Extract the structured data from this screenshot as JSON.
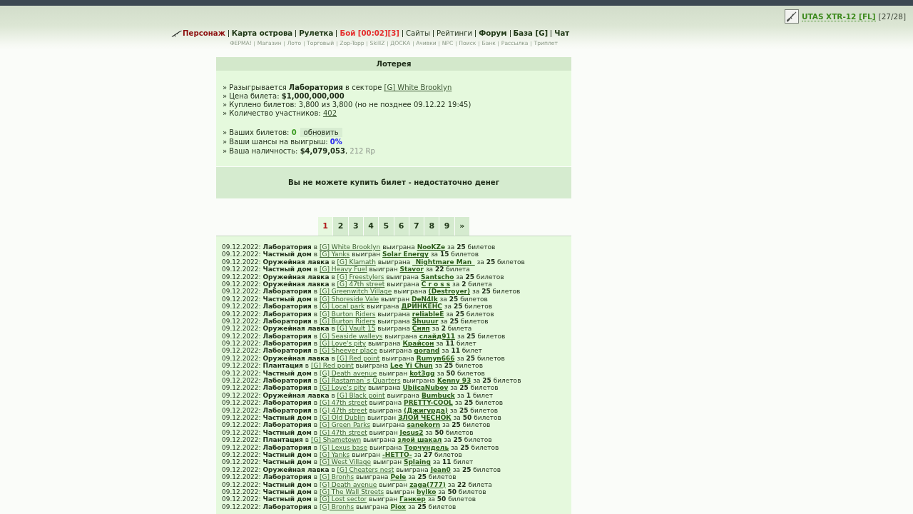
{
  "top_bar": {
    "weapon": {
      "name": "UTAS XTR-12 [FL]",
      "ammo": "[27/28]"
    }
  },
  "nav": {
    "main": [
      {
        "label": "Персонаж",
        "kind": "accent"
      },
      {
        "label": "Карта острова",
        "kind": "bold"
      },
      {
        "label": "Рулетка",
        "kind": "bold"
      },
      {
        "label": "Бой [00:02][3]",
        "kind": "alert"
      },
      {
        "label": "Сайты",
        "kind": "regular"
      },
      {
        "label": "Рейтинги",
        "kind": "regular"
      },
      {
        "label": "Форум",
        "kind": "bold"
      },
      {
        "label": "База [G]",
        "kind": "bold"
      },
      {
        "label": "Чат",
        "kind": "bold"
      }
    ],
    "sub": [
      "ФЕРМА!",
      "Магазин",
      "Лото",
      "Торговый",
      "Zop-Topp",
      "SkillZ",
      "ДОСКА",
      "Ачивки",
      "NPC",
      "Поиск",
      "Банк",
      "Рассылка",
      "Триплет"
    ]
  },
  "lottery": {
    "title": "Лотерея",
    "info_groups": [
      [
        {
          "kind": "link",
          "text": "» Разыгрывается **Лаборатория** в секторе",
          "link": "[G] White Brooklyn"
        },
        {
          "kind": "text",
          "text": "» Цена билета: **$1,000,000,000**"
        },
        {
          "kind": "text",
          "text": "» Куплено билетов: 3,800 из 3,800 (но не позднее 09.12.22 19:45)"
        },
        {
          "kind": "link",
          "text": "» Количество участников:",
          "link": "402"
        }
      ],
      [
        {
          "kind": "tickets",
          "text": "» Ваших билетов:",
          "value": "0",
          "button": "обновить"
        },
        {
          "kind": "chance",
          "text": "» Ваши шансы на выигрыш:",
          "value": "0%"
        },
        {
          "kind": "cash",
          "text": "» Ваша наличность: **$4,079,053**,",
          "extra": "212 Rp"
        }
      ]
    ],
    "message": "Вы не можете купить билет - недостаточно денег"
  },
  "pagination": [
    {
      "label": "1",
      "selected": true
    },
    {
      "label": "2",
      "selected": false
    },
    {
      "label": "3",
      "selected": false
    },
    {
      "label": "4",
      "selected": false
    },
    {
      "label": "5",
      "selected": false
    },
    {
      "label": "6",
      "selected": false
    },
    {
      "label": "7",
      "selected": false
    },
    {
      "label": "8",
      "selected": false
    },
    {
      "label": "9",
      "selected": false
    },
    {
      "label": "»",
      "selected": false
    }
  ],
  "results": [
    {
      "lead": "09.12.2022: **Лаборатория** в",
      "sector": "[G] White Brooklyn",
      "verb": "выиграна",
      "winner": "NooKZe",
      "tail": "за **25** билетов"
    },
    {
      "lead": "09.12.2022: **Частный дом** в",
      "sector": "[G] Yanks",
      "verb": "выигран",
      "winner": "Solar Energy",
      "tail": "за **15** билетов"
    },
    {
      "lead": "09.12.2022: **Оружейная лавка** в",
      "sector": "[G] Klamath",
      "verb": "выиграна",
      "winner": "_Nightmare Man_",
      "tail": "за **25** билетов"
    },
    {
      "lead": "09.12.2022: **Частный дом** в",
      "sector": "[G] Heavy Fuel",
      "verb": "выигран",
      "winner": "Stavor",
      "tail": "за **22** билета"
    },
    {
      "lead": "09.12.2022: **Оружейная лавка** в",
      "sector": "[G] Freestylers",
      "verb": "выиграна",
      "winner": "Santscho",
      "tail": "за **25** билетов"
    },
    {
      "lead": "09.12.2022: **Оружейная лавка** в",
      "sector": "[G] 47th street",
      "verb": "выиграна",
      "winner": "C r o s s",
      "tail": "за **2** билета"
    },
    {
      "lead": "09.12.2022: **Лаборатория** в",
      "sector": "[G] Greenwitch Village",
      "verb": "выиграна",
      "winner": "(Destroyer)",
      "tail": "за **25** билетов"
    },
    {
      "lead": "09.12.2022: **Частный дом** в",
      "sector": "[G] Shoreside Vale",
      "verb": "выигран",
      "winner": "DeN4Ik",
      "tail": "за **25** билетов"
    },
    {
      "lead": "09.12.2022: **Лаборатория** в",
      "sector": "[G] Local park",
      "verb": "выиграна",
      "winner": "ДРИНКЕНС",
      "tail": "за **25** билетов"
    },
    {
      "lead": "09.12.2022: **Лаборатория** в",
      "sector": "[G] Burton Riders",
      "verb": "выиграна",
      "winner": "reliableE",
      "tail": "за **25** билетов"
    },
    {
      "lead": "09.12.2022: **Лаборатория** в",
      "sector": "[G] Burton Riders",
      "verb": "выиграна",
      "winner": "Shuuur",
      "tail": "за **25** билетов"
    },
    {
      "lead": "09.12.2022: **Оружейная лавка** в",
      "sector": "[G] Vault 15",
      "verb": "выиграна",
      "winner": "Сняп",
      "tail": "за **2** билета"
    },
    {
      "lead": "09.12.2022: **Лаборатория** в",
      "sector": "[G] Seaside walleys",
      "verb": "выиграна",
      "winner": "слайд911",
      "tail": "за **25** билетов"
    },
    {
      "lead": "09.12.2022: **Лаборатория** в",
      "sector": "[G] Love's pity",
      "verb": "выиграна",
      "winner": "Крайсон",
      "tail": "за **11** билет"
    },
    {
      "lead": "09.12.2022: **Лаборатория** в",
      "sector": "[G] Sheever place",
      "verb": "выиграна",
      "winner": "gorand",
      "tail": "за **11** билет"
    },
    {
      "lead": "09.12.2022: **Оружейная лавка** в",
      "sector": "[G] Red point",
      "verb": "выиграна",
      "winner": "Rumyn666",
      "tail": "за **25** билетов"
    },
    {
      "lead": "09.12.2022: **Плантация** в",
      "sector": "[G] Red point",
      "verb": "выиграна",
      "winner": "Lee Yi Chun",
      "tail": "за **25** билетов"
    },
    {
      "lead": "09.12.2022: **Частный дом** в",
      "sector": "[G] Death avenue",
      "verb": "выигран",
      "winner": "kot3gg",
      "tail": "за **50** билетов"
    },
    {
      "lead": "09.12.2022: **Лаборатория** в",
      "sector": "[G] Rastaman`s Quarters",
      "verb": "выиграна",
      "winner": "Kenny 93",
      "tail": "за **25** билетов"
    },
    {
      "lead": "09.12.2022: **Лаборатория** в",
      "sector": "[G] Love's pity",
      "verb": "выиграна",
      "winner": "UbiicaNubov",
      "tail": "за **25** билетов"
    },
    {
      "lead": "09.12.2022: **Оружейная лавка** в",
      "sector": "[G] Black point",
      "verb": "выиграна",
      "winner": "Bumbuck",
      "tail": "за **1** билет"
    },
    {
      "lead": "09.12.2022: **Лаборатория** в",
      "sector": "[G] 47th street",
      "verb": "выиграна",
      "winner": "PRETTY-COOL",
      "tail": "за **25** билетов"
    },
    {
      "lead": "09.12.2022: **Лаборатория** в",
      "sector": "[G] 47th street",
      "verb": "выиграна",
      "winner": "(Джигурда)",
      "tail": "за **25** билетов"
    },
    {
      "lead": "09.12.2022: **Частный дом** в",
      "sector": "[G] Old Dublin",
      "verb": "выигран",
      "winner": "ЗЛОЙ ЧЕСНОК",
      "tail": "за **50** билетов"
    },
    {
      "lead": "09.12.2022: **Лаборатория** в",
      "sector": "[G] Green Parks",
      "verb": "выиграна",
      "winner": "sanekorn",
      "tail": "за **25** билетов"
    },
    {
      "lead": "09.12.2022: **Частный дом** в",
      "sector": "[G] 47th street",
      "verb": "выигран",
      "winner": "Jesus2",
      "tail": "за **50** билетов"
    },
    {
      "lead": "09.12.2022: **Плантация** в",
      "sector": "[G] Shametown",
      "verb": "выиграна",
      "winner": "злой шакал",
      "tail": "за **25** билетов"
    },
    {
      "lead": "09.12.2022: **Лаборатория** в",
      "sector": "[G] Lexus base",
      "verb": "выиграна",
      "winner": "Торчундель",
      "tail": "за **25** билетов"
    },
    {
      "lead": "09.12.2022: **Частный дом** в",
      "sector": "[G] Yanks",
      "verb": "выигран",
      "winner": "-HETTO-",
      "tail": "за **27** билетов"
    },
    {
      "lead": "09.12.2022: **Частный дом** в",
      "sector": "[G] West Village",
      "verb": "выигран",
      "winner": "Splaing",
      "tail": "за **11** билет"
    },
    {
      "lead": "09.12.2022: **Оружейная лавка** в",
      "sector": "[G] Cheaters nest",
      "verb": "выиграна",
      "winner": "Jean0",
      "tail": "за **25** билетов"
    },
    {
      "lead": "09.12.2022: **Лаборатория** в",
      "sector": "[G] Bronhs",
      "verb": "выиграна",
      "winner": "Pele",
      "tail": "за **25** билетов"
    },
    {
      "lead": "09.12.2022: **Частный дом** в",
      "sector": "[G] Death avenue",
      "verb": "выигран",
      "winner": "zaga(777)",
      "tail": "за **22** билета"
    },
    {
      "lead": "09.12.2022: **Частный дом** в",
      "sector": "[G] The Wall Streets",
      "verb": "выигран",
      "winner": "bylko",
      "tail": "за **50** билетов"
    },
    {
      "lead": "09.12.2022: **Частный дом** в",
      "sector": "[G] Lost sector",
      "verb": "выигран",
      "winner": "Ганкер",
      "tail": "за **50** билетов"
    },
    {
      "lead": "09.12.2022: **Лаборатория** в",
      "sector": "[G] Bronhs",
      "verb": "выиграна",
      "winner": "Piox",
      "tail": "за **25** билетов"
    }
  ]
}
